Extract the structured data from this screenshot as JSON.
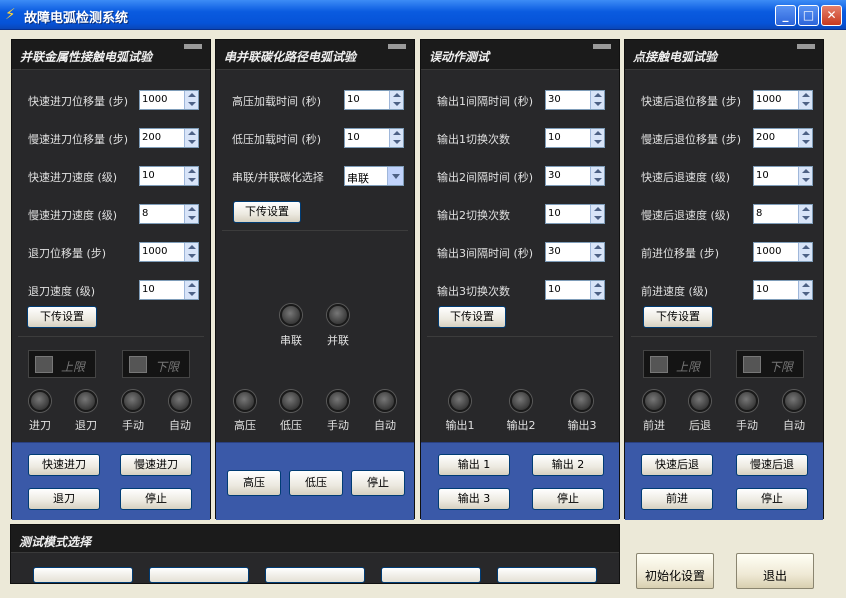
{
  "window": {
    "title": "故障电弧检测系统",
    "min_label": "_",
    "max_label": "□",
    "close_label": "✕"
  },
  "panels": {
    "p1": {
      "title": "并联金属性接触电弧试验",
      "fields": [
        {
          "label": "快速进刀位移量 (步)",
          "value": "1000"
        },
        {
          "label": "慢速进刀位移量 (步)",
          "value": "200"
        },
        {
          "label": "快速进刀速度 (级)",
          "value": "10"
        },
        {
          "label": "慢速进刀速度 (级)",
          "value": "8"
        },
        {
          "label": "退刀位移量 (步)",
          "value": "1000"
        },
        {
          "label": "退刀速度 (级)",
          "value": "10"
        }
      ],
      "upload": "下传设置",
      "upper": "上限",
      "lower": "下限",
      "leds": [
        "进刀",
        "退刀",
        "手动",
        "自动"
      ],
      "buttons": [
        "快速进刀",
        "慢速进刀",
        "退刀",
        "停止"
      ]
    },
    "p2": {
      "title": "串并联碳化路径电弧试验",
      "fields": [
        {
          "label": "高压加载时间 (秒)",
          "value": "10"
        },
        {
          "label": "低压加载时间 (秒)",
          "value": "10"
        }
      ],
      "select_label": "串联/并联碳化选择",
      "select_value": "串联",
      "upload": "下传设置",
      "leds_top": [
        "串联",
        "并联"
      ],
      "leds": [
        "高压",
        "低压",
        "手动",
        "自动"
      ],
      "buttons": [
        "高压",
        "低压",
        "停止"
      ]
    },
    "p3": {
      "title": "误动作测试",
      "fields": [
        {
          "label": "输出1间隔时间 (秒)",
          "value": "30"
        },
        {
          "label": "输出1切换次数",
          "value": "10"
        },
        {
          "label": "输出2间隔时间 (秒)",
          "value": "30"
        },
        {
          "label": "输出2切换次数",
          "value": "10"
        },
        {
          "label": "输出3间隔时间 (秒)",
          "value": "30"
        },
        {
          "label": "输出3切换次数",
          "value": "10"
        }
      ],
      "upload": "下传设置",
      "leds": [
        "输出1",
        "输出2",
        "输出3"
      ],
      "buttons": [
        "输出 1",
        "输出 2",
        "输出 3",
        "停止"
      ]
    },
    "p4": {
      "title": "点接触电弧试验",
      "fields": [
        {
          "label": "快速后退位移量 (步)",
          "value": "1000"
        },
        {
          "label": "慢速后退位移量 (步)",
          "value": "200"
        },
        {
          "label": "快速后退速度 (级)",
          "value": "10"
        },
        {
          "label": "慢速后退速度 (级)",
          "value": "8"
        },
        {
          "label": "前进位移量 (步)",
          "value": "1000"
        },
        {
          "label": "前进速度 (级)",
          "value": "10"
        }
      ],
      "upload": "下传设置",
      "upper": "上限",
      "lower": "下限",
      "leds": [
        "前进",
        "后退",
        "手动",
        "自动"
      ],
      "buttons": [
        "快速后退",
        "慢速后退",
        "前进",
        "停止"
      ]
    }
  },
  "mode": {
    "title": "测试模式选择"
  },
  "bottom": {
    "init": "初始化设置",
    "exit": "退出"
  }
}
